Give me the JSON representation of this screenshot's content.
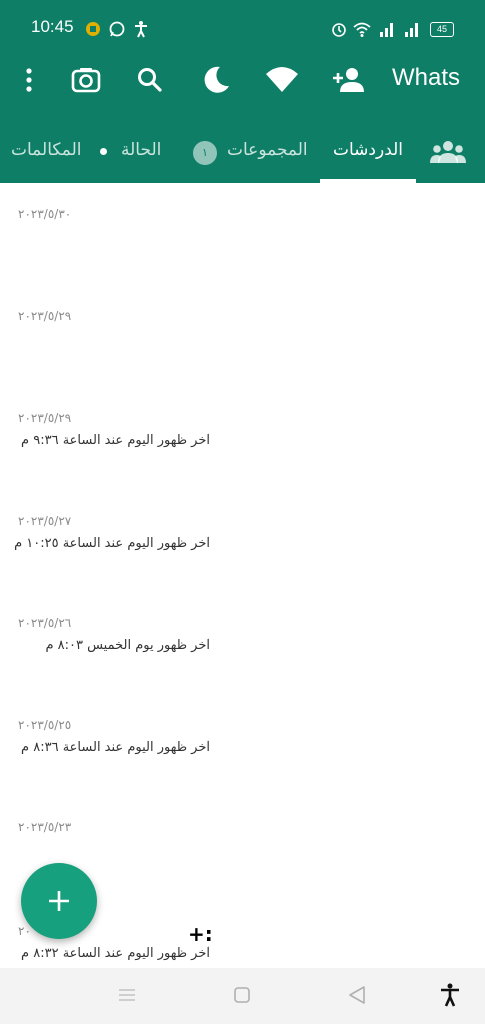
{
  "status_bar": {
    "time": "10:45",
    "battery": "45",
    "icons": [
      "record-icon",
      "whatsapp-icon",
      "accessibility-icon",
      "alarm-icon",
      "wifi-icon",
      "signal-icon",
      "signal-icon",
      "battery-icon"
    ]
  },
  "toolbar": {
    "title": "Whats",
    "icons": [
      "more-vert-icon",
      "camera-icon",
      "search-icon",
      "moon-icon",
      "wifi-icon",
      "add-contact-icon"
    ]
  },
  "tabs": [
    {
      "label": "المكالمات"
    },
    {
      "label": "الحالة"
    },
    {
      "label": "المجموعات",
      "badge": "١"
    },
    {
      "label": "الدردشات",
      "active": true
    }
  ],
  "chats": [
    {
      "date": "٢٠٢٣/٥/٣٠",
      "last_seen": ""
    },
    {
      "date": "٢٠٢٣/٥/٢٩",
      "last_seen": ""
    },
    {
      "date": "٢٠٢٣/٥/٢٩",
      "last_seen": "آخر ظهور اليوم عند الساعة ٩:٣٦ م"
    },
    {
      "date": "٢٠٢٣/٥/٢٧",
      "last_seen": "آخر ظهور اليوم عند الساعة ١٠:٢٥ م"
    },
    {
      "date": "٢٠٢٣/٥/٢٦",
      "last_seen": "آخر ظهور يوم الخميس ٨:٠٣ م"
    },
    {
      "date": "٢٠٢٣/٥/٢٥",
      "last_seen": "آخر ظهور اليوم عند الساعة ٨:٣٦ م"
    },
    {
      "date": "٢٠٢٣/٥/٢٣",
      "last_seen": ""
    },
    {
      "date": "٢٠",
      "last_seen": "آخر ظهور اليوم عند الساعة ٨:٣٢ م"
    }
  ],
  "overlay_text": "+:",
  "fab": {
    "icon": "plus-icon"
  },
  "colors": {
    "header": "#0e7f66",
    "fab": "#17a07d"
  }
}
